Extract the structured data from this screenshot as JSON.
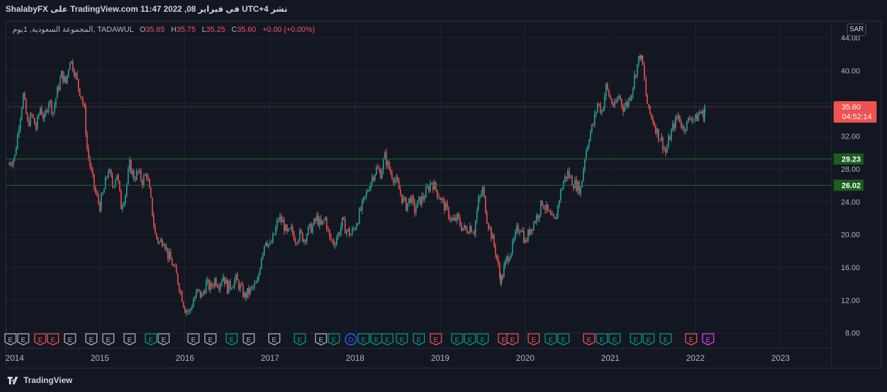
{
  "header": {
    "publish_line": "ShalabyFX على TradingView.com 11:47 2022 ,08 في فبراير UTC+4 نشر"
  },
  "legend": {
    "symbol": "المجموعة السعودية, 1يوم, TADAWUL",
    "o_label": "O",
    "o_value": "35.65",
    "h_label": "H",
    "h_value": "35.75",
    "l_label": "L",
    "l_value": "35.25",
    "c_label": "C",
    "c_value": "35.60",
    "change": "+0.00 (+0.00%)"
  },
  "currency": "SAR",
  "footer": {
    "brand": "TradingView"
  },
  "colors": {
    "background": "#131722",
    "grid": "#1f2430",
    "up": "#26a69a",
    "down": "#ef5350",
    "price_line": "#ef5350",
    "level_line": "#1e6b2e",
    "level_label": "#1b5e20"
  },
  "chart_data": {
    "type": "candlestick",
    "symbol": "TADAWUL",
    "timeframe": "1D",
    "x_ticks": [
      "2014",
      "2015",
      "2016",
      "2017",
      "2018",
      "2019",
      "2020",
      "2021",
      "2022",
      "2023"
    ],
    "y_ticks": [
      "8.00",
      "12.00",
      "16.00",
      "20.00",
      "24.00",
      "28.00",
      "32.00",
      "36.00",
      "40.00",
      "44.00"
    ],
    "ylim": [
      6.2,
      46.0
    ],
    "xlim": [
      2013.9,
      2023.6
    ],
    "series_close": [
      [
        2013.92,
        28.5
      ],
      [
        2014.0,
        29.5
      ],
      [
        2014.05,
        33.5
      ],
      [
        2014.1,
        37.0
      ],
      [
        2014.15,
        33.5
      ],
      [
        2014.2,
        34.5
      ],
      [
        2014.25,
        33.0
      ],
      [
        2014.3,
        35.5
      ],
      [
        2014.35,
        34.0
      ],
      [
        2014.4,
        36.5
      ],
      [
        2014.45,
        35.0
      ],
      [
        2014.5,
        37.5
      ],
      [
        2014.55,
        39.5
      ],
      [
        2014.6,
        38.5
      ],
      [
        2014.65,
        41.5
      ],
      [
        2014.7,
        40.0
      ],
      [
        2014.75,
        38.0
      ],
      [
        2014.78,
        37.0
      ],
      [
        2014.82,
        35.0
      ],
      [
        2014.85,
        30.5
      ],
      [
        2014.9,
        27.5
      ],
      [
        2014.95,
        25.0
      ],
      [
        2015.0,
        23.5
      ],
      [
        2015.05,
        25.5
      ],
      [
        2015.1,
        28.0
      ],
      [
        2015.15,
        26.0
      ],
      [
        2015.2,
        27.5
      ],
      [
        2015.25,
        23.5
      ],
      [
        2015.3,
        25.0
      ],
      [
        2015.35,
        28.5
      ],
      [
        2015.4,
        27.0
      ],
      [
        2015.45,
        27.5
      ],
      [
        2015.5,
        26.5
      ],
      [
        2015.55,
        27.5
      ],
      [
        2015.6,
        24.0
      ],
      [
        2015.65,
        20.0
      ],
      [
        2015.7,
        19.0
      ],
      [
        2015.75,
        19.5
      ],
      [
        2015.8,
        17.5
      ],
      [
        2015.85,
        16.5
      ],
      [
        2015.9,
        15.0
      ],
      [
        2015.95,
        13.0
      ],
      [
        2016.0,
        11.0
      ],
      [
        2016.05,
        10.5
      ],
      [
        2016.1,
        12.0
      ],
      [
        2016.15,
        13.0
      ],
      [
        2016.2,
        12.5
      ],
      [
        2016.25,
        14.0
      ],
      [
        2016.3,
        13.5
      ],
      [
        2016.35,
        14.5
      ],
      [
        2016.4,
        14.0
      ],
      [
        2016.45,
        15.0
      ],
      [
        2016.5,
        13.5
      ],
      [
        2016.55,
        14.0
      ],
      [
        2016.6,
        14.5
      ],
      [
        2016.65,
        13.5
      ],
      [
        2016.7,
        12.5
      ],
      [
        2016.75,
        13.0
      ],
      [
        2016.8,
        13.5
      ],
      [
        2016.85,
        14.0
      ],
      [
        2016.9,
        17.5
      ],
      [
        2016.95,
        19.5
      ],
      [
        2017.0,
        18.5
      ],
      [
        2017.05,
        20.0
      ],
      [
        2017.1,
        22.0
      ],
      [
        2017.15,
        21.5
      ],
      [
        2017.2,
        20.0
      ],
      [
        2017.25,
        20.5
      ],
      [
        2017.3,
        19.5
      ],
      [
        2017.35,
        20.0
      ],
      [
        2017.4,
        19.5
      ],
      [
        2017.45,
        20.5
      ],
      [
        2017.5,
        21.0
      ],
      [
        2017.55,
        22.0
      ],
      [
        2017.6,
        21.0
      ],
      [
        2017.65,
        22.0
      ],
      [
        2017.7,
        19.5
      ],
      [
        2017.75,
        19.0
      ],
      [
        2017.8,
        20.0
      ],
      [
        2017.85,
        21.5
      ],
      [
        2017.9,
        20.5
      ],
      [
        2017.95,
        20.0
      ],
      [
        2018.0,
        21.0
      ],
      [
        2018.05,
        22.5
      ],
      [
        2018.1,
        24.0
      ],
      [
        2018.15,
        25.5
      ],
      [
        2018.2,
        27.0
      ],
      [
        2018.25,
        28.0
      ],
      [
        2018.3,
        27.5
      ],
      [
        2018.35,
        29.5
      ],
      [
        2018.4,
        28.0
      ],
      [
        2018.45,
        27.0
      ],
      [
        2018.5,
        26.0
      ],
      [
        2018.55,
        24.5
      ],
      [
        2018.6,
        23.5
      ],
      [
        2018.65,
        24.5
      ],
      [
        2018.7,
        23.0
      ],
      [
        2018.75,
        24.0
      ],
      [
        2018.8,
        24.5
      ],
      [
        2018.85,
        25.5
      ],
      [
        2018.9,
        26.5
      ],
      [
        2018.95,
        25.5
      ],
      [
        2019.0,
        24.5
      ],
      [
        2019.05,
        23.5
      ],
      [
        2019.1,
        22.5
      ],
      [
        2019.15,
        21.5
      ],
      [
        2019.2,
        22.0
      ],
      [
        2019.25,
        21.0
      ],
      [
        2019.3,
        20.5
      ],
      [
        2019.35,
        21.0
      ],
      [
        2019.4,
        20.5
      ],
      [
        2019.45,
        24.0
      ],
      [
        2019.5,
        25.5
      ],
      [
        2019.55,
        22.0
      ],
      [
        2019.6,
        20.0
      ],
      [
        2019.65,
        18.0
      ],
      [
        2019.7,
        15.0
      ],
      [
        2019.72,
        14.5
      ],
      [
        2019.78,
        17.0
      ],
      [
        2019.85,
        18.5
      ],
      [
        2019.9,
        20.5
      ],
      [
        2019.95,
        21.0
      ],
      [
        2020.0,
        19.0
      ],
      [
        2020.05,
        20.5
      ],
      [
        2020.1,
        21.5
      ],
      [
        2020.15,
        22.5
      ],
      [
        2020.2,
        24.0
      ],
      [
        2020.25,
        23.0
      ],
      [
        2020.3,
        22.0
      ],
      [
        2020.35,
        21.5
      ],
      [
        2020.4,
        24.5
      ],
      [
        2020.45,
        26.5
      ],
      [
        2020.5,
        27.5
      ],
      [
        2020.55,
        26.5
      ],
      [
        2020.6,
        26.0
      ],
      [
        2020.65,
        25.5
      ],
      [
        2020.7,
        29.5
      ],
      [
        2020.75,
        32.0
      ],
      [
        2020.8,
        33.5
      ],
      [
        2020.85,
        36.0
      ],
      [
        2020.9,
        35.0
      ],
      [
        2020.95,
        38.0
      ],
      [
        2021.0,
        36.5
      ],
      [
        2021.05,
        35.5
      ],
      [
        2021.1,
        37.0
      ],
      [
        2021.15,
        35.5
      ],
      [
        2021.2,
        36.0
      ],
      [
        2021.25,
        37.5
      ],
      [
        2021.3,
        40.0
      ],
      [
        2021.35,
        42.0
      ],
      [
        2021.38,
        40.5
      ],
      [
        2021.42,
        37.0
      ],
      [
        2021.45,
        35.0
      ],
      [
        2021.5,
        34.0
      ],
      [
        2021.55,
        32.5
      ],
      [
        2021.6,
        31.5
      ],
      [
        2021.65,
        30.0
      ],
      [
        2021.7,
        32.0
      ],
      [
        2021.75,
        33.5
      ],
      [
        2021.8,
        34.5
      ],
      [
        2021.85,
        33.0
      ],
      [
        2021.9,
        33.5
      ],
      [
        2021.95,
        34.5
      ],
      [
        2022.0,
        34.0
      ],
      [
        2022.05,
        35.0
      ],
      [
        2022.1,
        34.5
      ],
      [
        2022.11,
        35.6
      ]
    ],
    "last_price": "35.60",
    "countdown": "04:52:14",
    "horizontal_levels": [
      {
        "value": 29.23,
        "label": "29.23"
      },
      {
        "value": 26.02,
        "label": "26.02"
      }
    ],
    "events": [
      {
        "x": 2013.95,
        "letter": "E",
        "kind": "neutral"
      },
      {
        "x": 2014.1,
        "letter": "E",
        "kind": "neutral"
      },
      {
        "x": 2014.3,
        "letter": "E",
        "kind": "bad"
      },
      {
        "x": 2014.45,
        "letter": "E",
        "kind": "bad"
      },
      {
        "x": 2014.65,
        "letter": "E",
        "kind": "neutral"
      },
      {
        "x": 2014.9,
        "letter": "E",
        "kind": "neutral"
      },
      {
        "x": 2015.1,
        "letter": "E",
        "kind": "neutral"
      },
      {
        "x": 2015.35,
        "letter": "E",
        "kind": "neutral"
      },
      {
        "x": 2015.6,
        "letter": "E",
        "kind": "good"
      },
      {
        "x": 2015.75,
        "letter": "E",
        "kind": "neutral"
      },
      {
        "x": 2016.1,
        "letter": "E",
        "kind": "neutral"
      },
      {
        "x": 2016.3,
        "letter": "E",
        "kind": "neutral"
      },
      {
        "x": 2016.55,
        "letter": "E",
        "kind": "good"
      },
      {
        "x": 2016.75,
        "letter": "E",
        "kind": "neutral"
      },
      {
        "x": 2017.05,
        "letter": "E",
        "kind": "neutral"
      },
      {
        "x": 2017.35,
        "letter": "E",
        "kind": "good"
      },
      {
        "x": 2017.6,
        "letter": "E",
        "kind": "neutral"
      },
      {
        "x": 2017.75,
        "letter": "E",
        "kind": "good"
      },
      {
        "x": 2017.95,
        "letter": "D",
        "kind": "dividend"
      },
      {
        "x": 2018.1,
        "letter": "E",
        "kind": "good"
      },
      {
        "x": 2018.25,
        "letter": "E",
        "kind": "good"
      },
      {
        "x": 2018.38,
        "letter": "E",
        "kind": "good"
      },
      {
        "x": 2018.55,
        "letter": "E",
        "kind": "good"
      },
      {
        "x": 2018.75,
        "letter": "E",
        "kind": "good"
      },
      {
        "x": 2018.95,
        "letter": "E",
        "kind": "bad"
      },
      {
        "x": 2019.2,
        "letter": "E",
        "kind": "good"
      },
      {
        "x": 2019.35,
        "letter": "E",
        "kind": "good"
      },
      {
        "x": 2019.5,
        "letter": "E",
        "kind": "good"
      },
      {
        "x": 2019.75,
        "letter": "E",
        "kind": "bad"
      },
      {
        "x": 2019.85,
        "letter": "E",
        "kind": "bad"
      },
      {
        "x": 2020.1,
        "letter": "E",
        "kind": "bad"
      },
      {
        "x": 2020.3,
        "letter": "E",
        "kind": "good"
      },
      {
        "x": 2020.45,
        "letter": "E",
        "kind": "good"
      },
      {
        "x": 2020.75,
        "letter": "E",
        "kind": "bad"
      },
      {
        "x": 2020.9,
        "letter": "E",
        "kind": "good"
      },
      {
        "x": 2021.05,
        "letter": "E",
        "kind": "good"
      },
      {
        "x": 2021.3,
        "letter": "E",
        "kind": "good"
      },
      {
        "x": 2021.45,
        "letter": "E",
        "kind": "good"
      },
      {
        "x": 2021.65,
        "letter": "E",
        "kind": "good"
      },
      {
        "x": 2021.95,
        "letter": "E",
        "kind": "bad"
      },
      {
        "x": 2022.15,
        "letter": "E",
        "kind": "future"
      }
    ]
  }
}
